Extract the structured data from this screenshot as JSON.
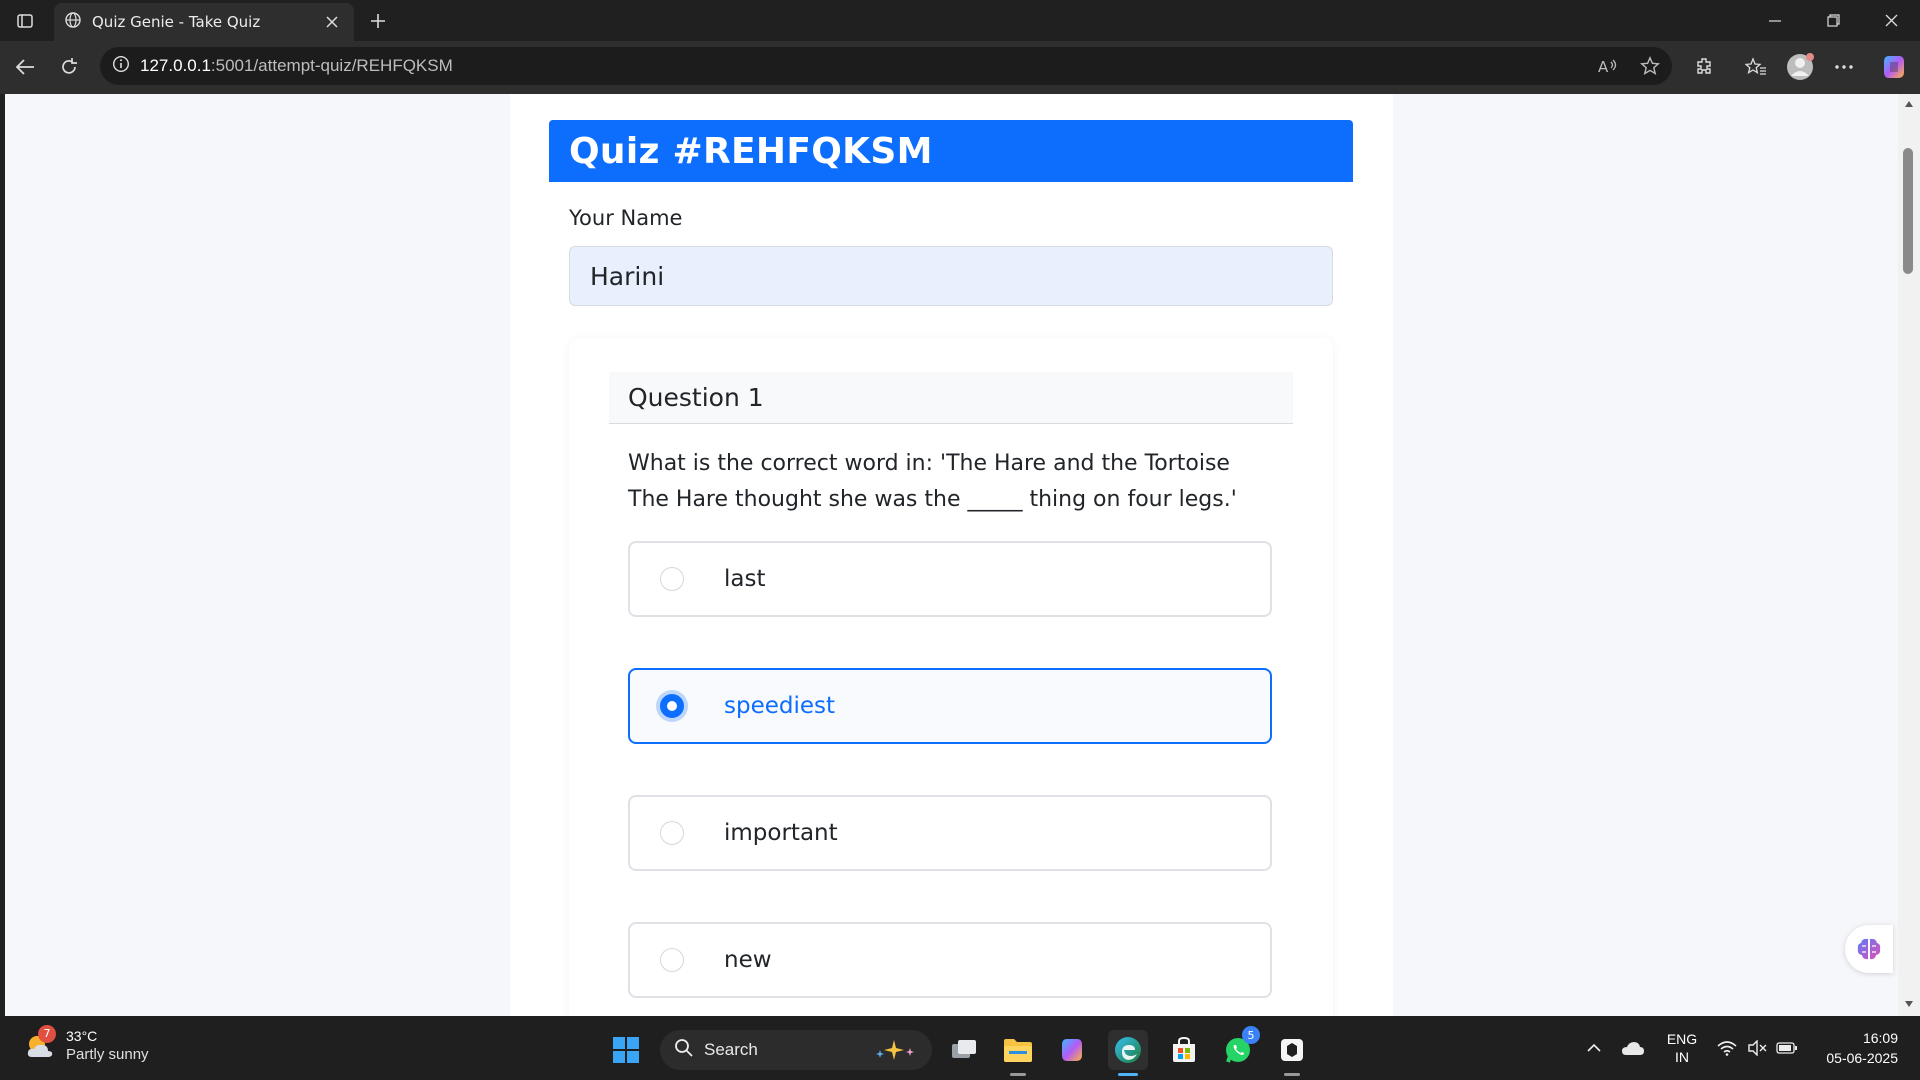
{
  "browser": {
    "tab_title": "Quiz Genie - Take Quiz",
    "url_host": "127.0.0.1",
    "url_path": ":5001/attempt-quiz/REHFQKSM"
  },
  "quiz": {
    "title": "Quiz #REHFQKSM",
    "name_label": "Your Name",
    "name_value": "Harini",
    "question": {
      "number_label": "Question 1",
      "text": "What is the correct word in: 'The Hare and the Tortoise The Hare thought she was the _____ thing on four legs.'",
      "options": [
        {
          "label": "last",
          "selected": false
        },
        {
          "label": "speediest",
          "selected": true
        },
        {
          "label": "important",
          "selected": false
        },
        {
          "label": "new",
          "selected": false
        }
      ]
    }
  },
  "taskbar": {
    "weather_badge": "7",
    "weather_temp": "33°C",
    "weather_desc": "Partly sunny",
    "search_label": "Search",
    "whatsapp_badge": "5",
    "lang_1": "ENG",
    "lang_2": "IN",
    "time": "16:09",
    "date": "05-06-2025"
  },
  "colors": {
    "primary": "#0d6efd",
    "input_bg": "#e8f0fe",
    "page_bg": "#f6f7fa"
  }
}
